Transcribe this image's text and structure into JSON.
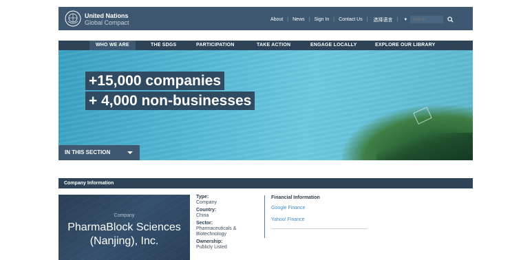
{
  "header": {
    "brand_line1": "United Nations",
    "brand_line2": "Global Compact",
    "links": [
      "About",
      "News",
      "Sign In",
      "Contact Us",
      "选择语言"
    ],
    "lang_caret": "▼",
    "search_placeholder": "Search"
  },
  "nav": {
    "items": [
      "WHO WE ARE",
      "THE SDGS",
      "PARTICIPATION",
      "TAKE ACTION",
      "ENGAGE LOCALLY",
      "EXPLORE OUR LIBRARY"
    ]
  },
  "hero": {
    "headline1": "+15,000 companies",
    "headline2": "+ 4,000 non-businesses",
    "section_button": "IN THIS SECTION"
  },
  "company_info": {
    "bar_title": "Company Information",
    "card_label": "Company",
    "company_name": "PharmaBlock Sciences (Nanjing), Inc.",
    "fields": [
      {
        "key": "Type:",
        "value": "Company"
      },
      {
        "key": "Country:",
        "value": "China"
      },
      {
        "key": "Sector:",
        "value": "Pharmaceuticals & Biotechnology"
      },
      {
        "key": "Ownership:",
        "value": "Publicly Listed"
      }
    ],
    "financial_title": "Financial Information",
    "financial_links": [
      "Google Finance",
      "Yahoo! Finance"
    ]
  },
  "icons": {
    "logo": "un-emblem-icon",
    "search": "search-icon",
    "dropdown": "caret-down-icon"
  },
  "colors": {
    "header_bg": "#3d5870",
    "nav_bg": "#2e4357",
    "link": "#3f8fc7"
  }
}
